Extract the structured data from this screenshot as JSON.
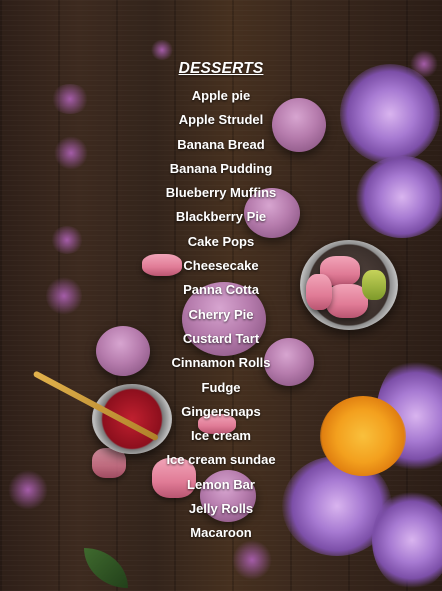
{
  "menu": {
    "title": "DESSERTS",
    "items": [
      "Apple pie",
      "Apple Strudel",
      "Banana Bread",
      "Banana Pudding",
      "Blueberry Muffins",
      "Blackberry Pie",
      "Cake Pops",
      "Cheesecake",
      "Panna Cotta",
      "Cherry Pie",
      "Custard Tart",
      "Cinnamon Rolls",
      "Fudge",
      "Gingersnaps",
      "Ice cream",
      "Ice cream sundae",
      "Lemon Bar",
      "Jelly Rolls",
      "Macaroon"
    ]
  },
  "background": {
    "wood_color": "#3d2a1f",
    "frosting_color": "#b67cad",
    "macaron_color": "#e07b96",
    "flower_color": "#a77ad2",
    "accent_flower_color": "#f3a01e"
  }
}
